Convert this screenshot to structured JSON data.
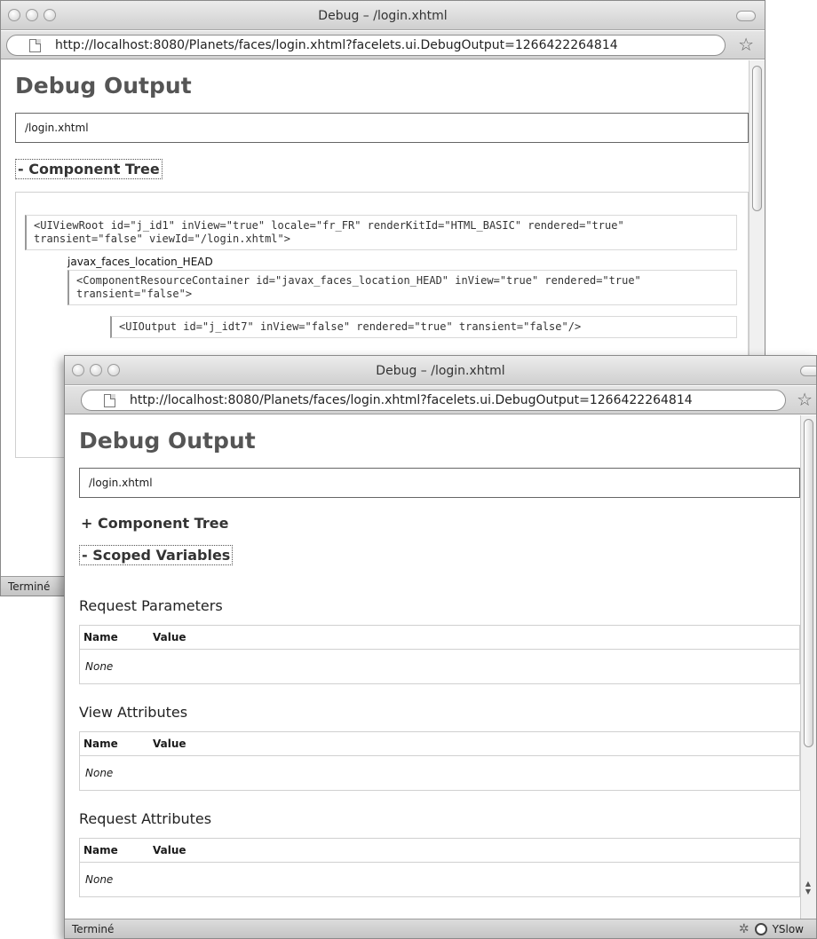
{
  "windows": [
    {
      "title": "Debug – /login.xhtml",
      "url": "http://localhost:8080/Planets/faces/login.xhtml?facelets.ui.DebugOutput=1266422264814",
      "heading": "Debug Output",
      "path": "/login.xhtml",
      "component_toggle": "- Component Tree",
      "tree": {
        "root": "<UIViewRoot id=\"j_id1\" inView=\"true\" locale=\"fr_FR\" renderKitId=\"HTML_BASIC\" rendered=\"true\" transient=\"false\" viewId=\"/login.xhtml\">",
        "facet_label": "javax_faces_location_HEAD",
        "container": "<ComponentResourceContainer id=\"javax_faces_location_HEAD\" inView=\"true\" rendered=\"true\" transient=\"false\">",
        "output": "<UIOutput id=\"j_idt7\" inView=\"false\" rendered=\"true\" transient=\"false\"/>"
      },
      "status": "Terminé"
    },
    {
      "title": "Debug – /login.xhtml",
      "url": "http://localhost:8080/Planets/faces/login.xhtml?facelets.ui.DebugOutput=1266422264814",
      "heading": "Debug Output",
      "path": "/login.xhtml",
      "component_toggle": "+ Component Tree",
      "scoped_toggle": "- Scoped Variables",
      "sections": [
        {
          "title": "Request Parameters",
          "col_name": "Name",
          "col_value": "Value",
          "row": "None"
        },
        {
          "title": "View Attributes",
          "col_name": "Name",
          "col_value": "Value",
          "row": "None"
        },
        {
          "title": "Request Attributes",
          "col_name": "Name",
          "col_value": "Value",
          "row": "None"
        }
      ],
      "status": "Terminé",
      "yslow": "YSlow"
    }
  ]
}
